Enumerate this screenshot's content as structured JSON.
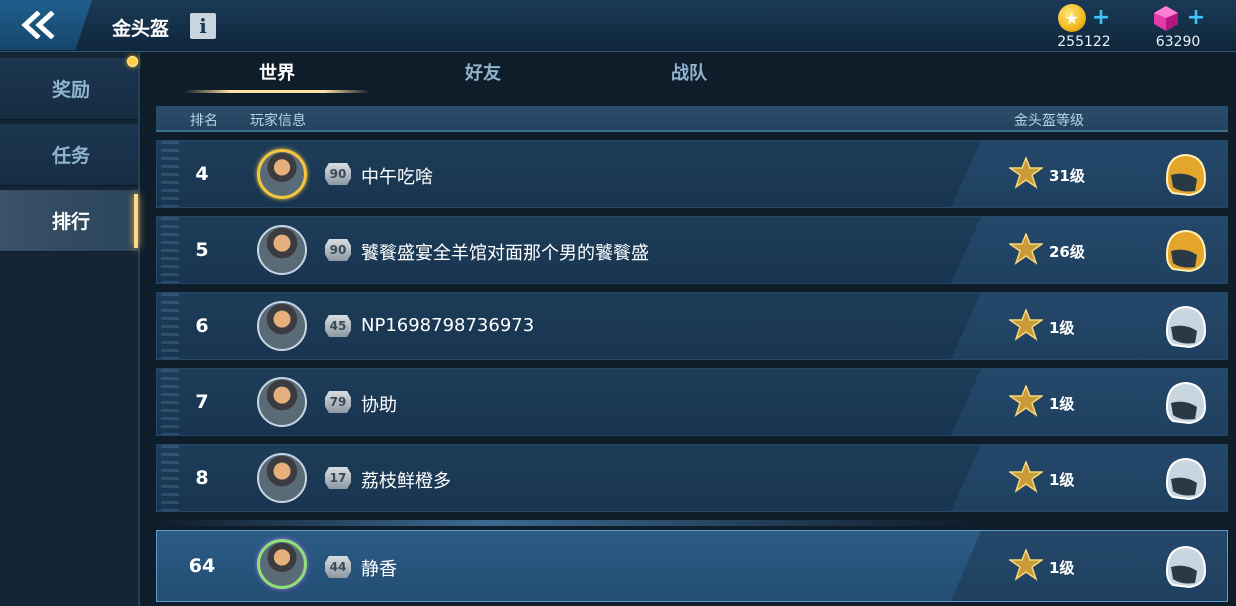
{
  "header": {
    "title": "金头盔",
    "info_label": "i",
    "coins": "255122",
    "gems": "63290"
  },
  "sidebar": {
    "items": [
      {
        "label": "奖励"
      },
      {
        "label": "任务"
      },
      {
        "label": "排行"
      }
    ]
  },
  "tabs": [
    {
      "label": "世界"
    },
    {
      "label": "好友"
    },
    {
      "label": "战队"
    }
  ],
  "list_header": {
    "rank": "排名",
    "player": "玩家信息",
    "helmet_level": "金头盔等级"
  },
  "rows": [
    {
      "rank": "4",
      "level": "90",
      "name": "中午吃啥",
      "helmet": "31级",
      "gold": true
    },
    {
      "rank": "5",
      "level": "90",
      "name": "饕餮盛宴全羊馆对面那个男的饕餮盛",
      "helmet": "26级",
      "gold": true
    },
    {
      "rank": "6",
      "level": "45",
      "name": "NP1698798736973",
      "helmet": "1级",
      "gold": false
    },
    {
      "rank": "7",
      "level": "79",
      "name": "协助",
      "helmet": "1级",
      "gold": false
    },
    {
      "rank": "8",
      "level": "17",
      "name": "荔枝鲜橙多",
      "helmet": "1级",
      "gold": false
    }
  ],
  "self_row": {
    "rank": "64",
    "level": "44",
    "name": "静香",
    "helmet": "1级"
  },
  "colors": {
    "accent_gold": "#ffd98a",
    "currency_plus": "#3fc6f7",
    "row_bg": "#1d3d59",
    "self_row_bg": "#2b5c86"
  }
}
